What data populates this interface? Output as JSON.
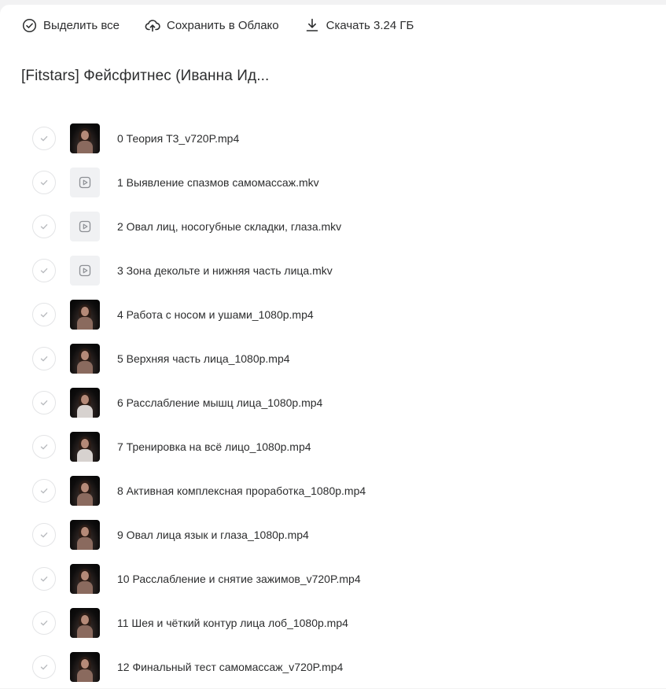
{
  "toolbar": {
    "select_all": {
      "label": "Выделить все",
      "icon": "check-circle-icon"
    },
    "save_cloud": {
      "label": "Сохранить в Облако",
      "icon": "cloud-upload-icon"
    },
    "download": {
      "label": "Скачать 3.24 ГБ",
      "icon": "download-icon"
    }
  },
  "folder": {
    "title": "[Fitstars] Фейсфитнес (Иванна Ид..."
  },
  "files": [
    {
      "name": "0 Теория Т3_v720P.mp4",
      "thumb": "photo"
    },
    {
      "name": "1 Выявление спазмов самомассаж.mkv",
      "thumb": "video-file-icon"
    },
    {
      "name": "2 Овал лиц, носогубные складки, глаза.mkv",
      "thumb": "video-file-icon"
    },
    {
      "name": "3 Зона декольте и нижняя часть лица.mkv",
      "thumb": "video-file-icon"
    },
    {
      "name": "4 Работа с носом и ушами_1080p.mp4",
      "thumb": "photo"
    },
    {
      "name": "5 Верхняя часть лица_1080p.mp4",
      "thumb": "photo"
    },
    {
      "name": "6 Расслабление мышц лица_1080p.mp4",
      "thumb": "photo-light"
    },
    {
      "name": "7 Тренировка на всё лицо_1080p.mp4",
      "thumb": "photo-light"
    },
    {
      "name": "8 Активная комплексная проработка_1080p.mp4",
      "thumb": "photo"
    },
    {
      "name": "9 Овал лица язык и глаза_1080p.mp4",
      "thumb": "photo"
    },
    {
      "name": "10 Расслабление и снятие зажимов_v720P.mp4",
      "thumb": "photo"
    },
    {
      "name": "11 Шея и чёткий контур лица лоб_1080p.mp4",
      "thumb": "photo"
    },
    {
      "name": "12 Финальный тест самомассаж_v720P.mp4",
      "thumb": "photo"
    }
  ]
}
